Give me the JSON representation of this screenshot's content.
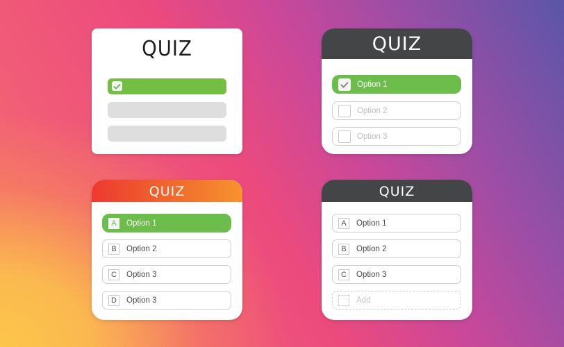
{
  "colors": {
    "green": "#6cbd4b",
    "dark_header": "#444547",
    "orange_header_start": "#ec3a30",
    "orange_header_end": "#f7932f",
    "grey_placeholder": "#dedede"
  },
  "cards": [
    {
      "title": "QUIZ",
      "style": "plain",
      "bars": [
        {
          "state": "checked",
          "icon": "check-icon"
        },
        {
          "state": "placeholder"
        },
        {
          "state": "placeholder"
        }
      ]
    },
    {
      "title": "QUIZ",
      "style": "dark-header",
      "options": [
        {
          "label": "Option 1",
          "checked": true
        },
        {
          "label": "Option 2",
          "checked": false
        },
        {
          "label": "Option 3",
          "checked": false
        }
      ]
    },
    {
      "title": "QUIZ",
      "style": "orange-header",
      "options": [
        {
          "letter": "A",
          "label": "Option 1",
          "selected": true
        },
        {
          "letter": "B",
          "label": "Option 2",
          "selected": false
        },
        {
          "letter": "C",
          "label": "Option 3",
          "selected": false
        },
        {
          "letter": "D",
          "label": "Option 3",
          "selected": false
        }
      ]
    },
    {
      "title": "QUIZ",
      "style": "dark-header",
      "options": [
        {
          "letter": "A",
          "label": "Option 1"
        },
        {
          "letter": "B",
          "label": "Option 2"
        },
        {
          "letter": "C",
          "label": "Option 3"
        }
      ],
      "add_label": "Add"
    }
  ]
}
